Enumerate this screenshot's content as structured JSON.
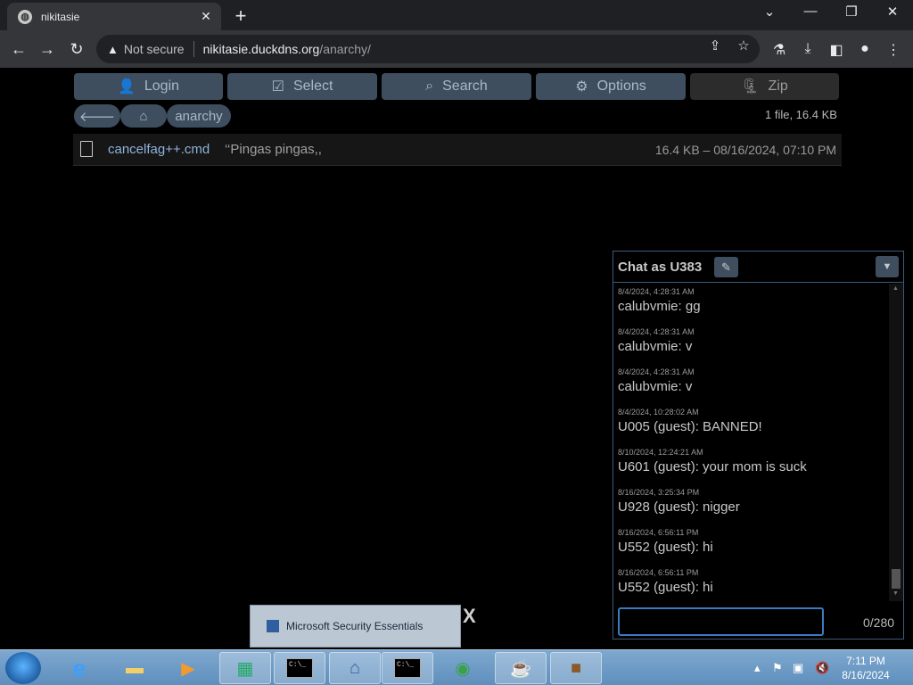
{
  "browser": {
    "tab_title": "nikitasie",
    "tab_close": "✕",
    "new_tab": "+",
    "window_controls": {
      "minimize": "—",
      "restore": "❐",
      "close": "✕",
      "tab_search": "⌄"
    },
    "nav": {
      "back": "←",
      "forward": "→",
      "reload": "↻"
    },
    "omnibox": {
      "security_label": "Not secure",
      "host": "nikitasie.duckdns.org",
      "path": "/anarchy/"
    }
  },
  "toolbar": {
    "buttons": [
      {
        "label": "Login",
        "icon": "user-icon"
      },
      {
        "label": "Select",
        "icon": "checkbox-icon"
      },
      {
        "label": "Search",
        "icon": "search-icon"
      },
      {
        "label": "Options",
        "icon": "gear-icon"
      },
      {
        "label": "Zip",
        "icon": "zip-icon"
      }
    ]
  },
  "breadcrumb": {
    "back_icon": "arrow-left-icon",
    "home_icon": "home-icon",
    "folder": "anarchy"
  },
  "file_count": "1 file, 16.4 KB",
  "files": [
    {
      "name": "cancelfag++.cmd",
      "description": "‘‘Pingas pingas,,",
      "meta": "16.4 KB – 08/16/2024, 07:10 PM"
    }
  ],
  "chat": {
    "title": "Chat as U383",
    "char_count": "0/280",
    "messages": [
      {
        "time": "8/4/2024, 4:28:31 AM",
        "text": "calubvmie: gg"
      },
      {
        "time": "8/4/2024, 4:28:31 AM",
        "text": "calubvmie: v"
      },
      {
        "time": "8/4/2024, 4:28:31 AM",
        "text": "calubvmie: v"
      },
      {
        "time": "8/4/2024, 10:28:02 AM",
        "text": "U005 (guest): BANNED!"
      },
      {
        "time": "8/10/2024, 12:24:21 AM",
        "text": "U601 (guest): your mom is suck"
      },
      {
        "time": "8/16/2024, 3:25:34 PM",
        "text": "U928 (guest): nigger"
      },
      {
        "time": "8/16/2024, 6:56:11 PM",
        "text": "U552 (guest): hi"
      },
      {
        "time": "8/16/2024, 6:56:11 PM",
        "text": "U552 (guest): hi"
      }
    ]
  },
  "notification": {
    "title": "Microsoft Security Essentials",
    "close": "X"
  },
  "taskbar": {
    "cmd_text": "C:\\_",
    "time": "7:11 PM",
    "date": "8/16/2024"
  }
}
